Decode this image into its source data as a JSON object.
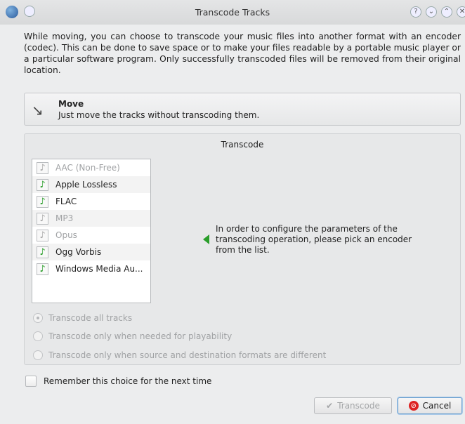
{
  "window": {
    "title": "Transcode Tracks",
    "buttons": {
      "help": "?",
      "minimize": "⌄",
      "maximize": "⌃",
      "close": "✕"
    }
  },
  "intro_text": "While moving, you can choose to transcode your music files into another format with an encoder (codec). This can be done to save space or to make your files readable by a portable music player or a particular software program. Only successfully transcoded files will be removed from their original location.",
  "move": {
    "title": "Move",
    "description": "Just move the tracks without transcoding them."
  },
  "transcode": {
    "group_title": "Transcode",
    "encoders": [
      {
        "label": "AAC (Non-Free)",
        "enabled": false
      },
      {
        "label": "Apple Lossless",
        "enabled": true
      },
      {
        "label": "FLAC",
        "enabled": true
      },
      {
        "label": "MP3",
        "enabled": false
      },
      {
        "label": "Opus",
        "enabled": false
      },
      {
        "label": "Ogg Vorbis",
        "enabled": true
      },
      {
        "label": "Windows Media Au...",
        "enabled": true
      }
    ],
    "info_text": "In order to configure the parameters of the transcoding operation, please pick an encoder from the list.",
    "options": [
      {
        "label": "Transcode all tracks",
        "selected": true
      },
      {
        "label": "Transcode only when needed for playability",
        "selected": false
      },
      {
        "label": "Transcode only when source and destination formats are different",
        "selected": false
      }
    ]
  },
  "remember_label": "Remember this choice for the next time",
  "buttons": {
    "transcode": "Transcode",
    "cancel": "Cancel"
  },
  "colors": {
    "accent_green": "#2a9e2a",
    "cancel_red": "#d22222",
    "focus_blue": "#6aa0cf"
  }
}
